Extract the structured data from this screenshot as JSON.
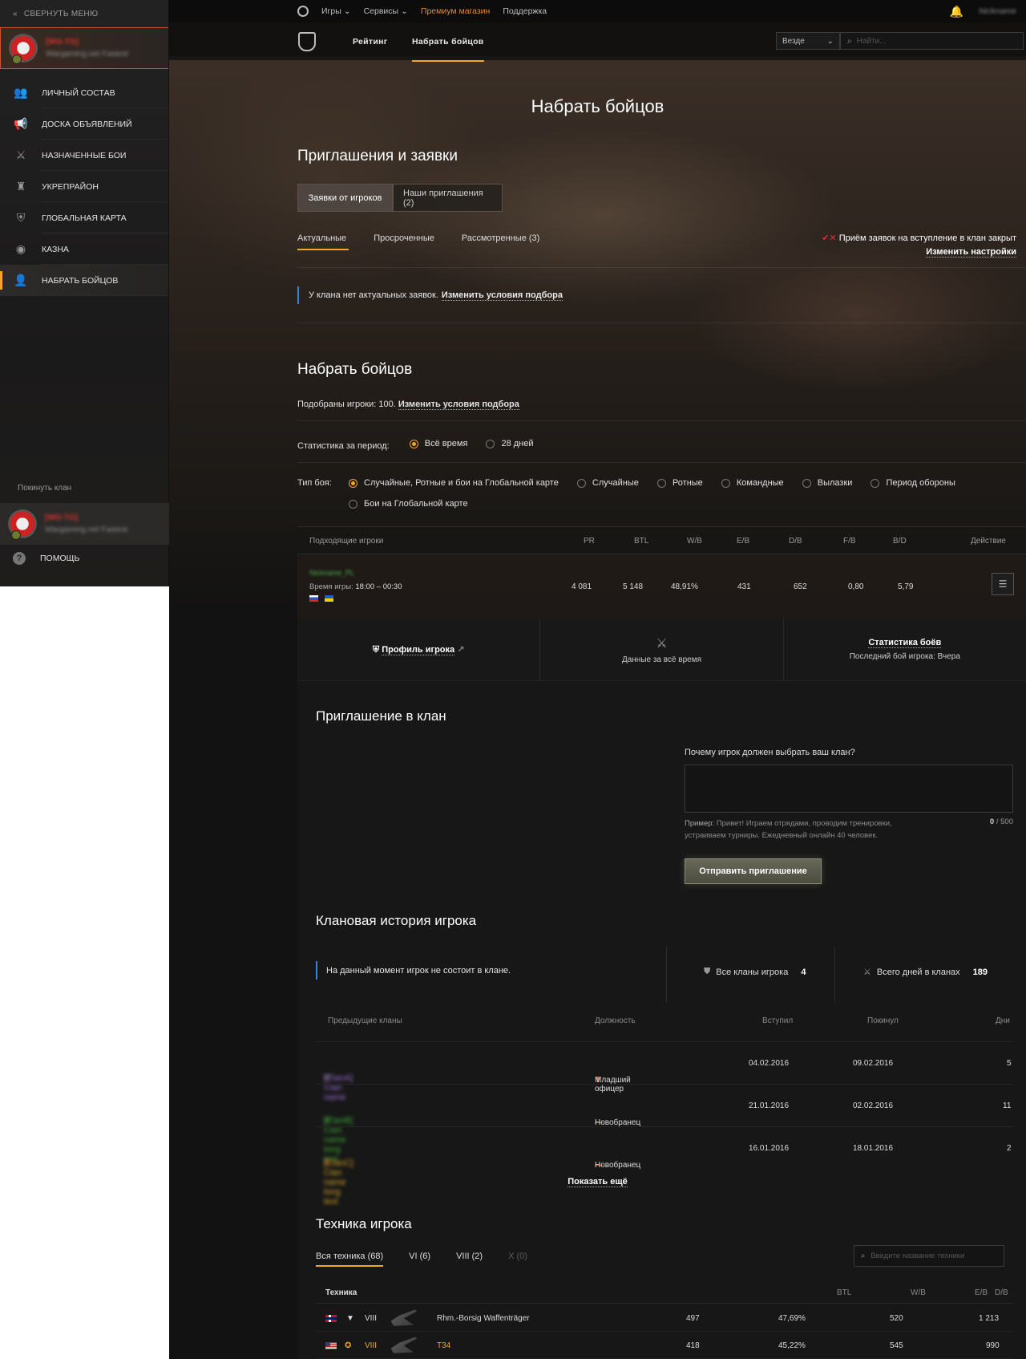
{
  "sidebar": {
    "collapse": "Свернуть меню",
    "clan_tag": "[WG-TG]",
    "clan_name": "Wargaming.net Fastest",
    "items": [
      {
        "label": "Личный состав",
        "icon": "users-icon"
      },
      {
        "label": "Доска объявлений",
        "icon": "megaphone-icon"
      },
      {
        "label": "Назначенные бои",
        "icon": "crossed-swords-icon"
      },
      {
        "label": "Укрепрайон",
        "icon": "fortress-icon"
      },
      {
        "label": "Глобальная карта",
        "icon": "map-shield-icon"
      },
      {
        "label": "Казна",
        "icon": "coins-icon"
      },
      {
        "label": "Набрать бойцов",
        "icon": "add-user-icon",
        "active": true
      }
    ],
    "leave_clan": "Покинуть клан",
    "help": "Помощь"
  },
  "topbar": {
    "games": "Игры",
    "services": "Сервисы",
    "premium": "Премиум магазин",
    "support": "Поддержка",
    "user": "Nickname"
  },
  "subnav": {
    "rating": "Рейтинг",
    "recruit": "Набрать бойцов",
    "region": "Везде",
    "search_placeholder": "Найти..."
  },
  "page_title": "Набрать бойцов",
  "invites": {
    "title": "Приглашения и заявки",
    "seg_requests": "Заявки от игроков",
    "seg_invites": "Наши приглашения (2)",
    "tab_actual": "Актуальные",
    "tab_expired": "Просроченные",
    "tab_reviewed": "Рассмотренные (3)",
    "closed": "Приём заявок на вступление в клан закрыт",
    "change_settings": "Изменить настройки",
    "no_requests": "У клана нет актуальных заявок.",
    "change_conditions": "Изменить условия подбора"
  },
  "recruit": {
    "title": "Набрать бойцов",
    "matched": "Подобраны игроки: 100.",
    "change_conditions": "Изменить условия подбора",
    "period_label": "Статистика за период:",
    "period_all": "Всё время",
    "period_28": "28 дней",
    "battle_label": "Тип боя:",
    "battle_types": [
      "Случайные, Ротные и бои на Глобальной карте",
      "Случайные",
      "Ротные",
      "Командные",
      "Вылазки",
      "Период обороны"
    ],
    "battle_type_extra": "Бои на Глобальной карте"
  },
  "players_table": {
    "headers": {
      "players": "Подходящие игроки",
      "pr": "PR",
      "btl": "BTL",
      "wb": "W/B",
      "eb": "E/B",
      "db": "D/B",
      "fb": "F/B",
      "bd": "B/D",
      "action": "Действие"
    },
    "row": {
      "nick": "Nickname_PL",
      "time_label": "Время игры:",
      "time_value": "18:00 – 00:30",
      "pr": "4 081",
      "btl": "5 148",
      "wb": "48,91%",
      "eb": "431",
      "db": "652",
      "fb": "0,80",
      "bd": "5,79"
    },
    "profile": "Профиль игрока",
    "all_time": "Данные за всё время",
    "stats": "Статистика боёв",
    "last_battle": "Последний бой игрока: Вчера"
  },
  "invite": {
    "title": "Приглашение в клан",
    "question": "Почему игрок должен выбрать ваш клан?",
    "example_label": "Пример:",
    "example_text": "Привет! Играем отрядами, проводим тренировки, устраиваем турниры. Ежедневный онлайн 40 человек.",
    "count": "0",
    "max": "/ 500",
    "send": "Отправить приглашение"
  },
  "history": {
    "title": "Клановая история игрока",
    "note": "На данный момент игрок не состоит в клане.",
    "all_clans_label": "Все кланы игрока",
    "all_clans_value": "4",
    "days_label": "Всего дней в кланах",
    "days_value": "189",
    "headers": {
      "prev": "Предыдущие кланы",
      "role": "Должность",
      "joined": "Вступил",
      "left": "Покинул",
      "days": "Дни"
    },
    "rows": [
      {
        "clan": "[ClanA] Clan name",
        "role": "Младший офицер",
        "joined": "04.02.2016",
        "left": "09.02.2016",
        "days": "5",
        "color": "#7a3bd0"
      },
      {
        "clan": "[ClanB] Clan name long text",
        "role": "Новобранец",
        "joined": "21.01.2016",
        "left": "02.02.2016",
        "days": "11",
        "color": "#39a82f"
      },
      {
        "clan": "[ClanC] Clan name long text",
        "role": "Новобранец",
        "joined": "16.01.2016",
        "left": "18.01.2016",
        "days": "2",
        "color": "#d2a024"
      }
    ],
    "show_more": "Показать ещё"
  },
  "vehicles": {
    "title": "Техника игрока",
    "tabs": [
      "Вся техника (68)",
      "VI (6)",
      "VIII (2)",
      "X (0)"
    ],
    "search_placeholder": "Введите название техники",
    "headers": {
      "tech": "Техника",
      "btl": "BTL",
      "wb": "W/B",
      "eb": "E/B",
      "db": "D/B"
    },
    "rows": [
      {
        "tier": "VIII",
        "name": "Rhm.-Borsig Waffenträger",
        "btl": "497",
        "wb": "47,69%",
        "eb": "520",
        "db": "1 213",
        "nation": "de"
      },
      {
        "tier": "VIII",
        "name": "T34",
        "btl": "418",
        "wb": "45,22%",
        "eb": "545",
        "db": "990",
        "nation": "us"
      }
    ]
  }
}
